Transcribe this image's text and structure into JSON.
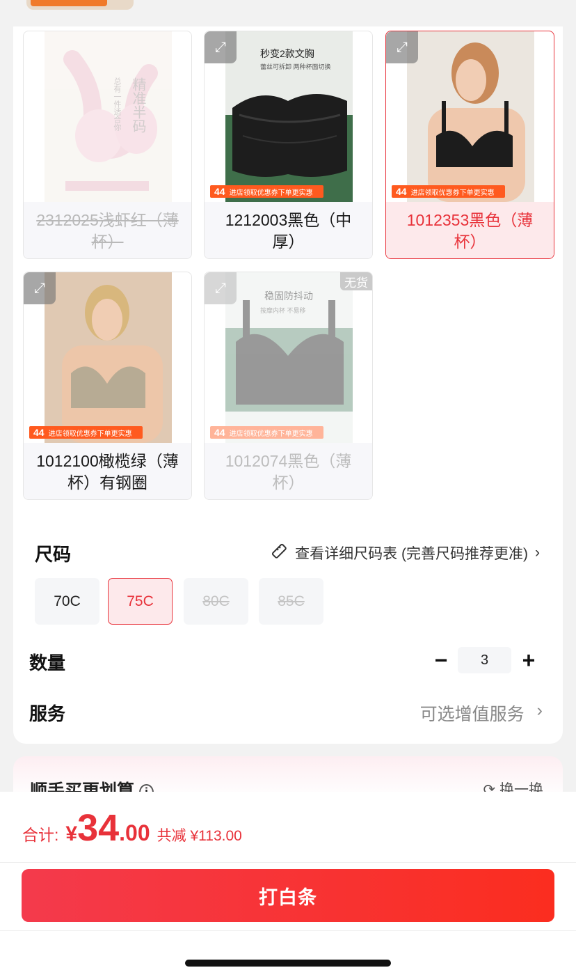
{
  "colors": {
    "accent": "#e8323a",
    "pay_gradient_start": "#f43a4c",
    "pay_gradient_end": "#fb2d1f"
  },
  "variants": [
    {
      "label": "2312025浅虾红（薄杯）",
      "state": "disabled",
      "image": "pink lace bra product photo",
      "side_text_1": "精准半码",
      "side_text_2": "总有一件适合你"
    },
    {
      "label": "1212003黑色（中厚）",
      "state": "normal",
      "image": "black strapless bra product photo",
      "caption": "秒变2款文胸",
      "sub_caption": "蕾丝可拆卸 两种杯面切换",
      "promo_price": "44",
      "promo_text": "进店领取优惠券下单更实惠"
    },
    {
      "label": "1012353黑色（薄杯）",
      "state": "selected",
      "image": "model wearing black bra",
      "promo_price": "44",
      "promo_text": "进店领取优惠券下单更实惠"
    },
    {
      "label": "1012100橄榄绿（薄杯）有钢圈",
      "state": "normal",
      "image": "model wearing olive bra",
      "promo_price": "44",
      "promo_text": "进店领取优惠券下单更实惠"
    },
    {
      "label": "1012074黑色（薄杯）",
      "state": "out_of_stock",
      "image": "black bra product photo",
      "caption": "稳固防抖动",
      "sub_caption": "按摩内杯 不易移",
      "tag": "无货",
      "promo_price": "44",
      "promo_text": "进店领取优惠券下单更实惠"
    }
  ],
  "size": {
    "title": "尺码",
    "link": "查看详细尺码表 (完善尺码推荐更准)",
    "options": [
      {
        "label": "70C",
        "state": "normal"
      },
      {
        "label": "75C",
        "state": "selected"
      },
      {
        "label": "80C",
        "state": "disabled"
      },
      {
        "label": "85C",
        "state": "disabled"
      }
    ]
  },
  "quantity": {
    "title": "数量",
    "value": "3",
    "minus": "−",
    "plus": "+"
  },
  "service": {
    "title": "服务",
    "value": "可选增值服务",
    "chevron": "›"
  },
  "bundle": {
    "title": "顺手买更划算",
    "swap": "换一换"
  },
  "footer": {
    "total_label": "合计:",
    "currency": "¥",
    "amount_int": "34",
    "amount_dec": ".00",
    "discount": "共减 ¥113.00",
    "pay_button": "打白条"
  }
}
